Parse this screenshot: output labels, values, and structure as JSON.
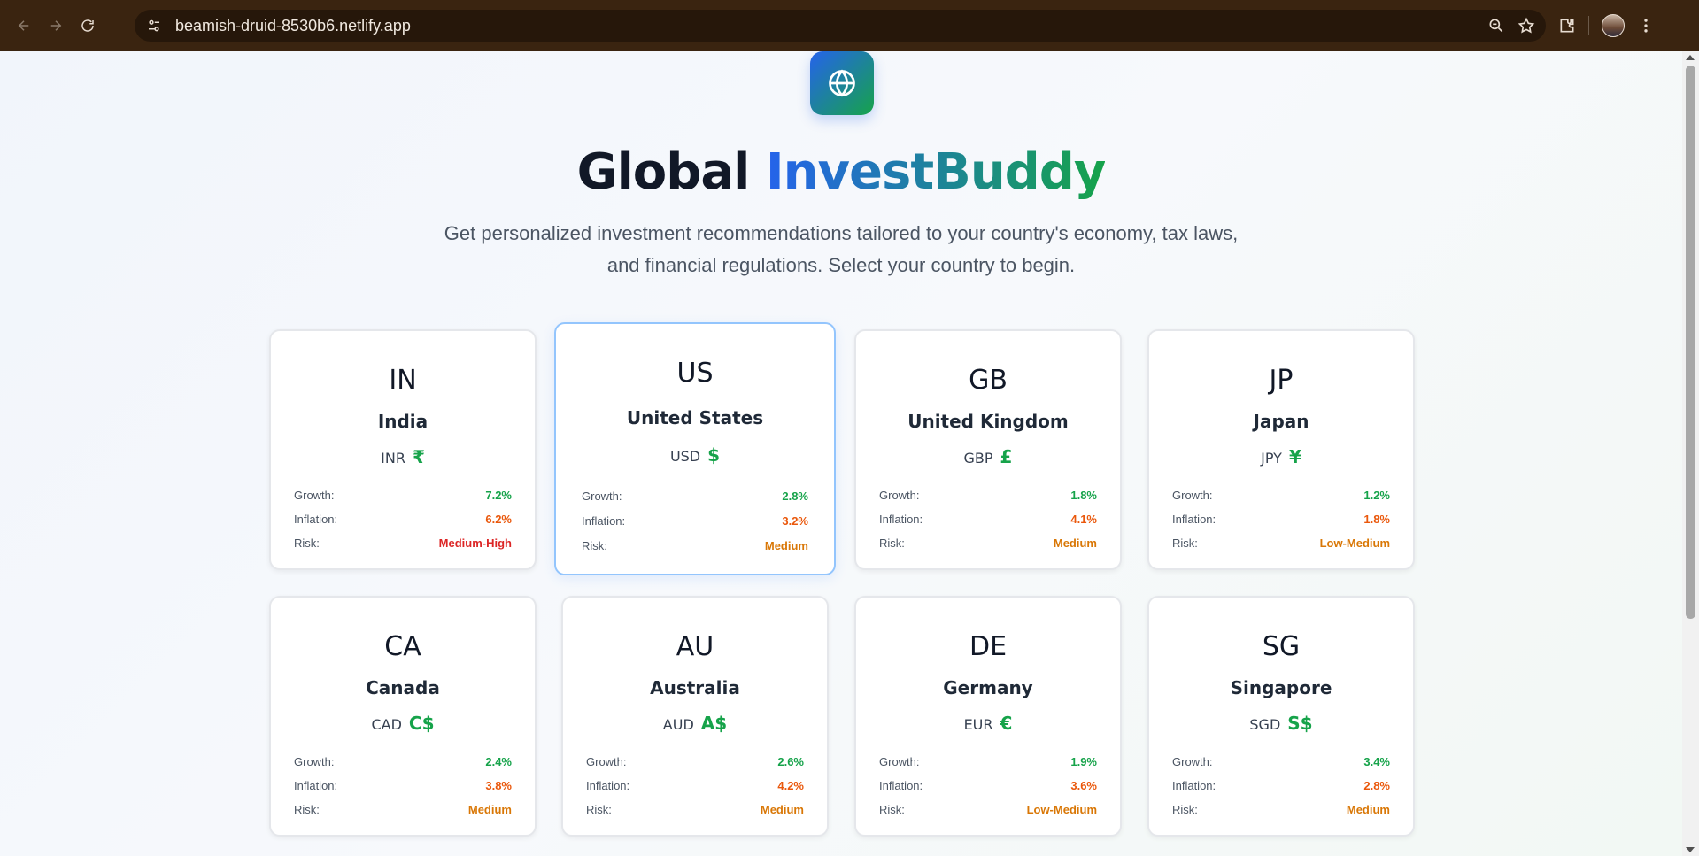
{
  "browser": {
    "url": "beamish-druid-8530b6.netlify.app"
  },
  "header": {
    "title_part1": "Global",
    "title_part2": "InvestBuddy",
    "subtitle": "Get personalized investment recommendations tailored to your country's economy, tax laws, and financial regulations. Select your country to begin."
  },
  "labels": {
    "growth": "Growth:",
    "inflation": "Inflation:",
    "risk": "Risk:"
  },
  "countries": [
    {
      "code": "IN",
      "name": "India",
      "currency": "INR",
      "symbol": "₹",
      "growth": "7.2%",
      "inflation": "6.2%",
      "risk": "Medium-High",
      "risk_color": "#dc2626"
    },
    {
      "code": "US",
      "name": "United States",
      "currency": "USD",
      "symbol": "$",
      "growth": "2.8%",
      "inflation": "3.2%",
      "risk": "Medium",
      "risk_color": "#d97706"
    },
    {
      "code": "GB",
      "name": "United Kingdom",
      "currency": "GBP",
      "symbol": "£",
      "growth": "1.8%",
      "inflation": "4.1%",
      "risk": "Medium",
      "risk_color": "#d97706"
    },
    {
      "code": "JP",
      "name": "Japan",
      "currency": "JPY",
      "symbol": "¥",
      "growth": "1.2%",
      "inflation": "1.8%",
      "risk": "Low-Medium",
      "risk_color": "#d97706"
    },
    {
      "code": "CA",
      "name": "Canada",
      "currency": "CAD",
      "symbol": "C$",
      "growth": "2.4%",
      "inflation": "3.8%",
      "risk": "Medium",
      "risk_color": "#d97706"
    },
    {
      "code": "AU",
      "name": "Australia",
      "currency": "AUD",
      "symbol": "A$",
      "growth": "2.6%",
      "inflation": "4.2%",
      "risk": "Medium",
      "risk_color": "#d97706"
    },
    {
      "code": "DE",
      "name": "Germany",
      "currency": "EUR",
      "symbol": "€",
      "growth": "1.9%",
      "inflation": "3.6%",
      "risk": "Low-Medium",
      "risk_color": "#d97706"
    },
    {
      "code": "SG",
      "name": "Singapore",
      "currency": "SGD",
      "symbol": "S$",
      "growth": "3.4%",
      "inflation": "2.8%",
      "risk": "Medium",
      "risk_color": "#d97706"
    }
  ],
  "colors": {
    "growth": "#16a34a",
    "inflation": "#ea580c",
    "brand_start": "#2563eb",
    "brand_end": "#16a34a"
  }
}
